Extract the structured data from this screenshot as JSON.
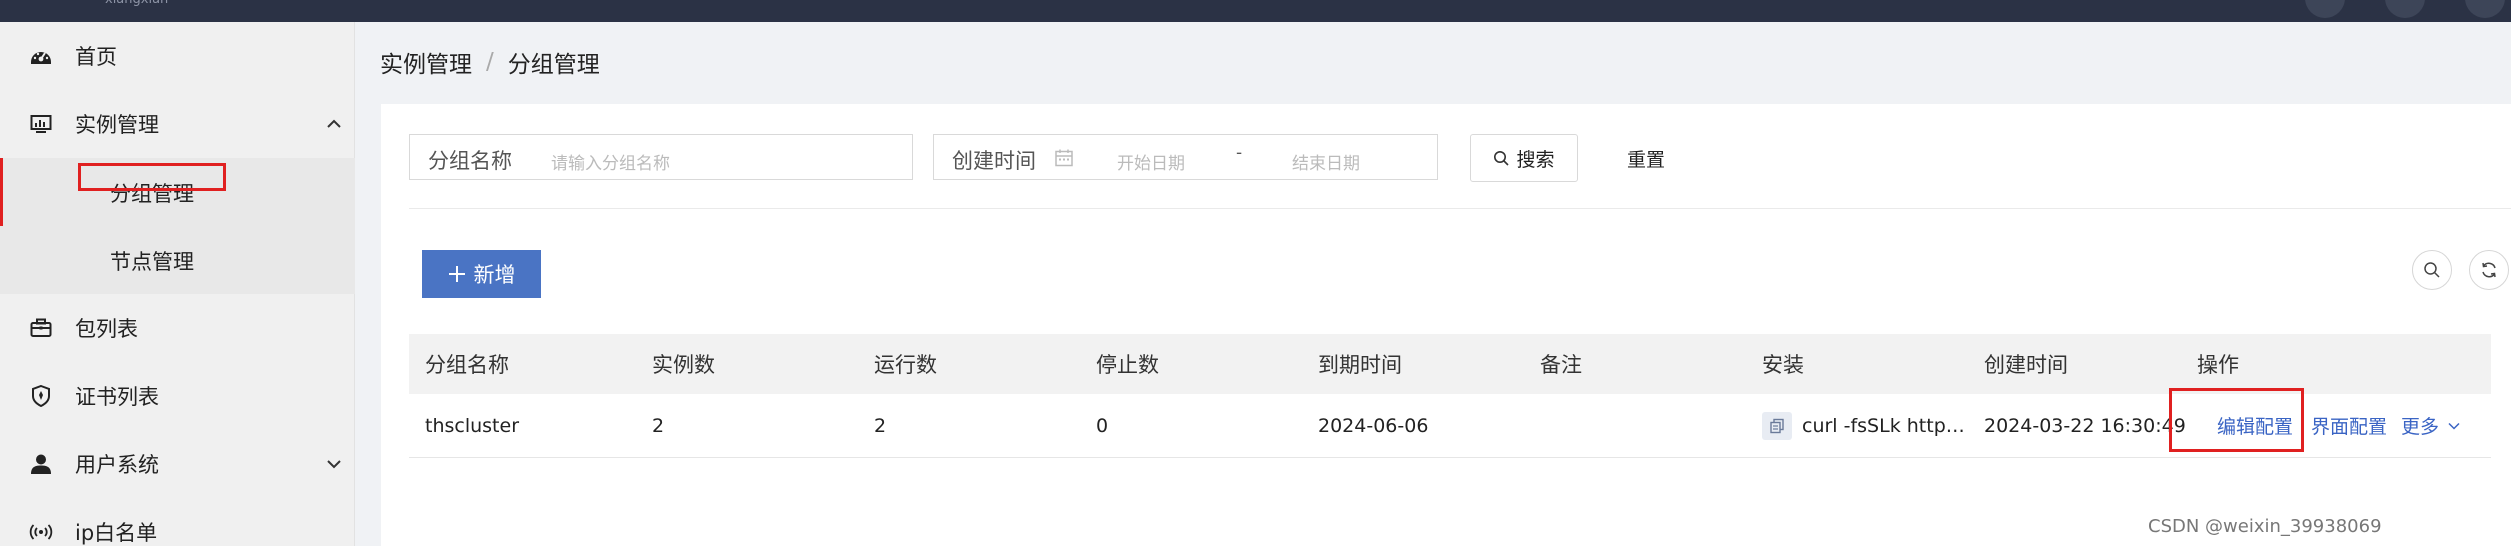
{
  "topbar": {
    "brand": "xiangxian"
  },
  "sidebar": {
    "items": [
      {
        "label": "首页",
        "icon": "dashboard-icon"
      },
      {
        "label": "实例管理",
        "icon": "monitor-icon",
        "expanded": true
      },
      {
        "label": "包列表",
        "icon": "briefcase-icon"
      },
      {
        "label": "证书列表",
        "icon": "shield-icon"
      },
      {
        "label": "用户系统",
        "icon": "user-icon",
        "expanded": false
      },
      {
        "label": "ip白名单",
        "icon": "broadcast-icon"
      }
    ],
    "subitems": [
      {
        "label": "分组管理",
        "active": true
      },
      {
        "label": "节点管理",
        "active": false
      }
    ]
  },
  "breadcrumb": {
    "parent": "实例管理",
    "sep": "/",
    "current": "分组管理"
  },
  "search": {
    "group_name_label": "分组名称",
    "group_name_placeholder": "请输入分组名称",
    "created_label": "创建时间",
    "start_placeholder": "开始日期",
    "range_sep": "-",
    "end_placeholder": "结束日期",
    "search_button": "搜索",
    "reset_button": "重置"
  },
  "toolbar": {
    "add_button": "新增"
  },
  "table": {
    "columns": [
      "分组名称",
      "实例数",
      "运行数",
      "停止数",
      "到期时间",
      "备注",
      "安装",
      "创建时间",
      "操作"
    ],
    "rows": [
      {
        "name": "thscluster",
        "instances": "2",
        "running": "2",
        "stopped": "0",
        "expire": "2024-06-06",
        "remark": "",
        "install": "curl -fsSLk http…",
        "created": "2024-03-22 16:30:49",
        "actions": {
          "edit": "编辑配置",
          "ui": "界面配置",
          "more": "更多"
        }
      }
    ]
  },
  "watermark": "CSDN @weixin_39938069",
  "colors": {
    "accent": "#4a74c4",
    "highlight": "#e02020",
    "link": "#3a64c4"
  }
}
